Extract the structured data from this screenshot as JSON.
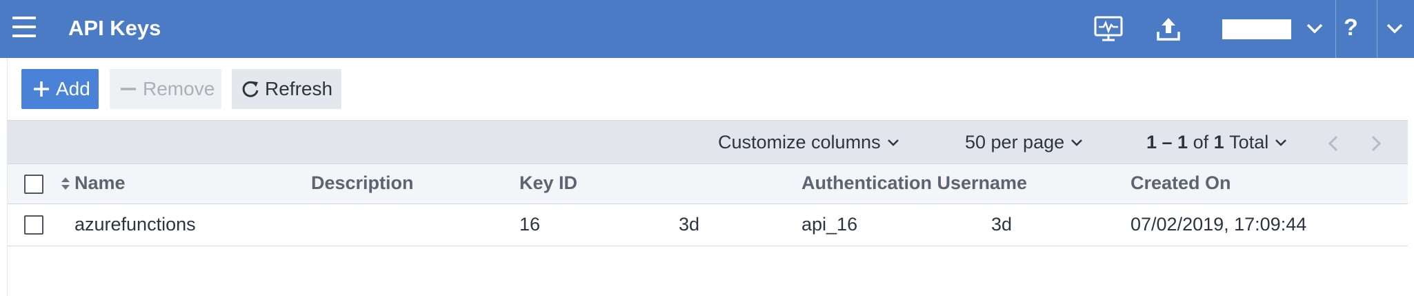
{
  "header": {
    "title": "API Keys",
    "icons": [
      "menu-icon",
      "monitor-icon",
      "upload-icon",
      "chevron-down-icon",
      "help-icon",
      "chevron-down-icon"
    ],
    "help_label": "?"
  },
  "toolbar": {
    "add_label": "Add",
    "remove_label": "Remove",
    "refresh_label": "Refresh"
  },
  "pager": {
    "customize_label": "Customize columns",
    "per_page_label": "50 per page",
    "range": "1 – 1",
    "of_label": "of",
    "total_count": "1",
    "total_label": "Total"
  },
  "table": {
    "columns": {
      "name": "Name",
      "description": "Description",
      "key_id": "Key ID",
      "auth_username": "Authentication Username",
      "created_on": "Created On"
    },
    "rows": [
      {
        "name": "azurefunctions",
        "description": "",
        "key_id_start": "16",
        "key_id_end": "3d",
        "auth_username_start": "api_16",
        "auth_username_end": "3d",
        "created_on": "07/02/2019, 17:09:44"
      }
    ]
  },
  "colors": {
    "header_bg": "#4a7bc4",
    "primary_button": "#4a82d8",
    "pager_bg": "#e2e6ec"
  }
}
